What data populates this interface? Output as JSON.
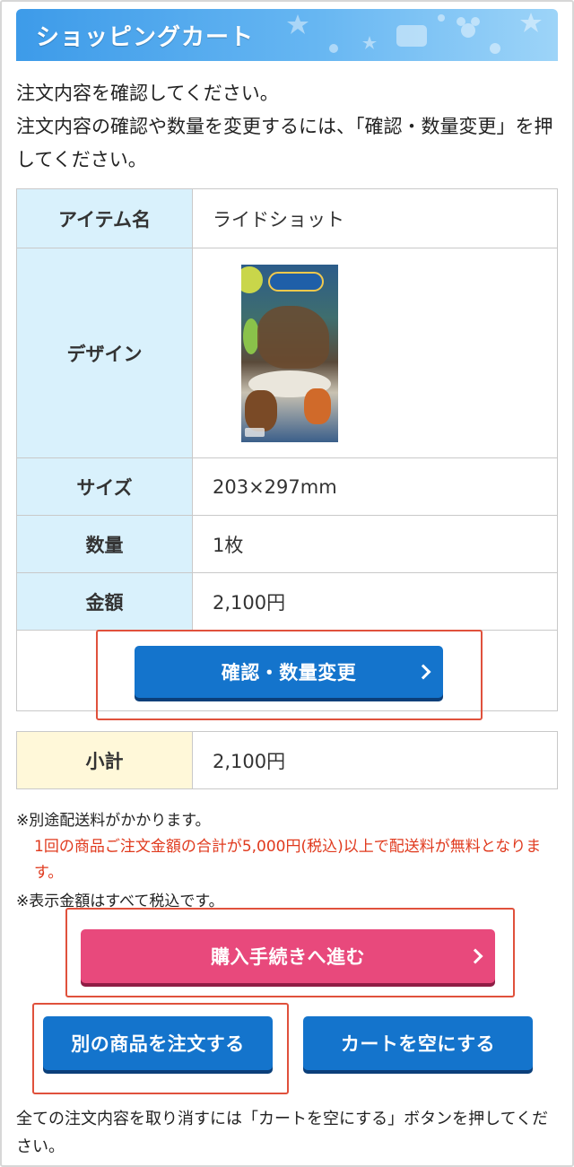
{
  "header": {
    "title": "ショッピングカート"
  },
  "intro": {
    "line1": "注文内容を確認してください。",
    "line2": "注文内容の確認や数量を変更するには、「確認・数量変更」を押してください。"
  },
  "item": {
    "name_label": "アイテム名",
    "name_value": "ライドショット",
    "design_label": "デザイン",
    "size_label": "サイズ",
    "size_value": "203×297mm",
    "quantity_label": "数量",
    "quantity_value": "1枚",
    "price_label": "金額",
    "price_value": "2,100円"
  },
  "buttons": {
    "confirm_quantity": "確認・数量変更",
    "checkout": "購入手続きへ進む",
    "order_other": "別の商品を注文する",
    "empty_cart": "カートを空にする"
  },
  "subtotal": {
    "label": "小計",
    "value": "2,100円"
  },
  "notes": {
    "shipping": "※別途配送料がかかります。",
    "free_shipping": "1回の商品ご注文金額の合計が5,000円(税込)以上で配送料が無料となります。",
    "tax": "※表示金額はすべて税込です。"
  },
  "footer": {
    "text": "全ての注文内容を取り消すには「カートを空にする」ボタンを押してください。"
  },
  "colors": {
    "header_blue": "#3d9be9",
    "label_bg": "#d9f1fc",
    "subtotal_bg": "#fff8d9",
    "button_blue": "#1474cc",
    "button_pink": "#e8497c",
    "highlight_red": "#e0513c",
    "notice_red": "#e03a1e"
  }
}
